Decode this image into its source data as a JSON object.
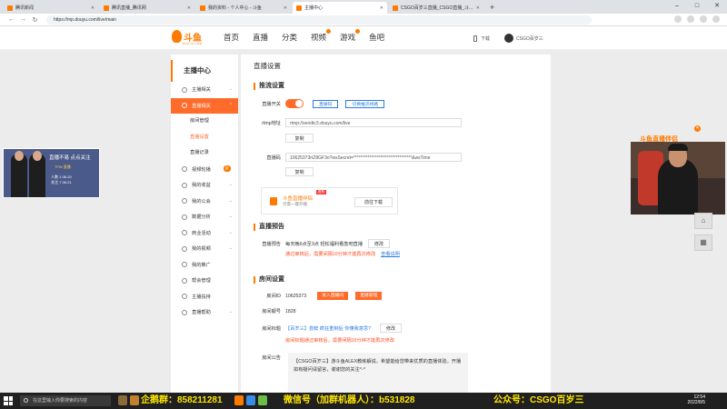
{
  "browser": {
    "tabs": [
      {
        "title": "腾讯新闻"
      },
      {
        "title": "腾讯直播_腾讯网"
      },
      {
        "title": "我的资料 - 个人中心 - 斗鱼"
      },
      {
        "title": "主播中心"
      },
      {
        "title": "CSGO百岁三直播_CSGO直播_斗..."
      }
    ],
    "url": "https://mp.douyu.com/live/main"
  },
  "header": {
    "logo_text": "斗鱼",
    "logo_sub": "DOUYU.COM",
    "nav": [
      "首页",
      "直播",
      "分类",
      "视频",
      "游戏",
      "鱼吧"
    ],
    "download_label": "下载",
    "user_name": "CSGO百岁三"
  },
  "sidebar": {
    "title": "主播中心",
    "items": [
      {
        "label": "主播相关"
      },
      {
        "label": "直播相关"
      },
      {
        "label": "房间管理"
      },
      {
        "label": "直播设置"
      },
      {
        "label": "直播记录"
      },
      {
        "label": "视频轮播",
        "badge": "新"
      },
      {
        "label": "我的收益"
      },
      {
        "label": "我的公会"
      },
      {
        "label": "数据分析"
      },
      {
        "label": "商业活动"
      },
      {
        "label": "我的视频"
      },
      {
        "label": "我的推广"
      },
      {
        "label": "帮会管理"
      },
      {
        "label": "主播扶持"
      },
      {
        "label": "直播帮助"
      }
    ]
  },
  "content": {
    "page_title": "直播设置",
    "stream_section": "推流设置",
    "stream_switch_label": "直播开关",
    "btn_stream_code": "直播码",
    "btn_stream_backup": "切换推流线路",
    "rtmp_label": "rtmp地址",
    "rtmp_value": "rtmp://sendtc3.douyu.com/live",
    "copy_label": "复制",
    "code_label": "直播码",
    "code_value": "10625373rIZ8GF3o?wsSecret=*********************************&wsTime",
    "copy_label_2": "复制",
    "promo_title": "斗鱼直播伴侣",
    "promo_sub": "仅需一键开播",
    "promo_badge": "推荐",
    "promo_download": "前往下载",
    "preview_section": "直播预告",
    "preview_label": "直播预告",
    "preview_text": "每天晚6点至3点 轻松福利看急吧直播",
    "preview_edit": "修改",
    "preview_warn": "通过审核后，需要间隔10分钟才能再次修改",
    "preview_link": "查看说明",
    "room_section": "房间设置",
    "room_id_label": "房间ID",
    "room_id_value": "10625373",
    "btn_enter_room": "进入直播间",
    "btn_vip_room": "直播管理",
    "room_num_label": "房间靓号",
    "room_num_value": "1828",
    "room_title_label": "房间标题",
    "room_title_value": "【百岁三】尝鲜 疯狂重制后 你懂我意思?",
    "room_title_edit": "修改",
    "room_title_warn": "房间标题通过审核后，需要间隔10分钟才能再次修改",
    "notice_label": "房间公告",
    "notice_text": "【CSGO百岁三】游斗鱼ALEX教练解说，希望能给您带来优质的直播体验，开播如有疑问请留言，谢谢您的关注^-^"
  },
  "overlay_left": {
    "title": "直播不易 点点关注",
    "brand": "TFW 直播",
    "lines": [
      "人数 1   08-20",
      "关注 7   08-21"
    ]
  },
  "overlay_right": {
    "tag": "斗鱼直播伴侣"
  },
  "taskbar": {
    "search_placeholder": "在这里输入你要搜索的内容",
    "ticker_1": "企鹅群：858211281",
    "ticker_2": "微信号（加群机器人）：b531828",
    "ticker_3": "公众号：CSGO百岁三",
    "time": "12:54",
    "date": "2022/8/5"
  }
}
